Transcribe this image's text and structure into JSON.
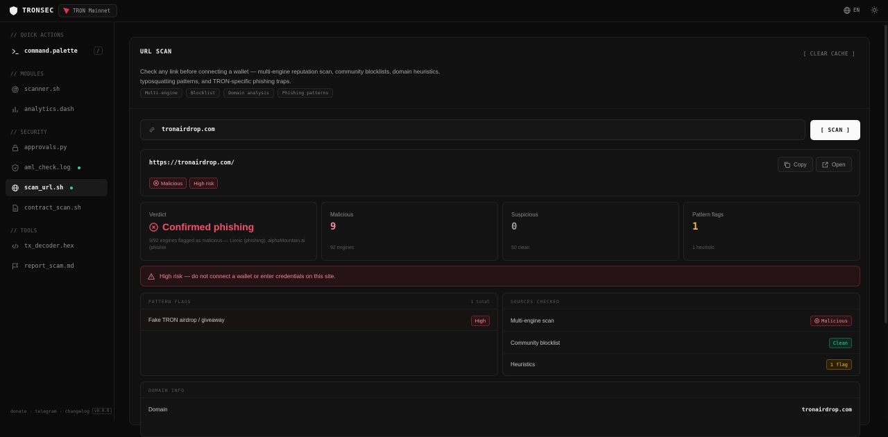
{
  "topbar": {
    "brand": "TRONSEC",
    "network": "TRON Mainnet",
    "language": "EN",
    "icons": [
      "shield-icon",
      "tron-logo-icon",
      "globe-icon",
      "sun-icon"
    ]
  },
  "sidebar": {
    "quick_actions_label": "// QUICK ACTIONS",
    "command_palette": "command.palette",
    "command_shortcut": "/",
    "modules_label": "// MODULES",
    "scanner": "scanner.sh",
    "analytics": "analytics.dash",
    "security_label": "// SECURITY",
    "approvals": "approvals.py",
    "aml_check": "aml_check.log",
    "scan_url": "scan_url.sh",
    "contract_scan": "contract_scan.sh",
    "tools_label": "// TOOLS",
    "tx_decoder": "tx_decoder.hex",
    "report_scam": "report_scam.md",
    "footer": {
      "donate": "donate",
      "telegram": "telegram",
      "changelog": "changelog",
      "sep": "·",
      "version": "v0.0.0"
    }
  },
  "main": {
    "title": "URL SCAN",
    "clear_cache": "[ CLEAR CACHE ]",
    "description": "Check any link before connecting a wallet — multi-engine reputation scan, community blocklists, domain heuristics, typosquatting patterns, and TRON-specific phishing traps.",
    "tags": [
      "Multi-engine",
      "Blocklist",
      "Domain analysis",
      "Phishing patterns"
    ],
    "input_value": "tronairdrop.com",
    "scan_label": "[ SCAN ]",
    "result": {
      "full_url": "https://tronairdrop.com/",
      "badge_malicious": "Malicious",
      "badge_risk": "High risk",
      "copy_label": "Copy",
      "open_label": "Open"
    },
    "stats": {
      "verdict_label": "Verdict",
      "verdict_value": "Confirmed phishing",
      "verdict_detail": "9/92 engines flagged as malicious — Lionic (phishing), alphaMountain.ai (phishin",
      "malicious_label": "Malicious",
      "malicious_value": "9",
      "malicious_sub": "92 engines",
      "suspicious_label": "Suspicious",
      "suspicious_value": "0",
      "suspicious_sub": "50 clean",
      "flags_label": "Pattern flags",
      "flags_value": "1",
      "flags_sub": "1 heuristic"
    },
    "alert": "High risk — do not connect a wallet or enter credentials on this site.",
    "pattern_flags": {
      "title": "PATTERN FLAGS",
      "count": "1 total",
      "items": [
        {
          "name": "Fake TRON airdrop / giveaway",
          "severity": "High"
        }
      ]
    },
    "sources": {
      "title": "SOURCES CHECKED",
      "items": [
        {
          "name": "Multi-engine scan",
          "status": "Malicious"
        },
        {
          "name": "Community blocklist",
          "status": "Clean"
        },
        {
          "name": "Heuristics",
          "status": "1 flag"
        }
      ]
    },
    "domain_info": {
      "title": "DOMAIN INFO",
      "domain_label": "Domain",
      "domain_value": "tronairdrop.com"
    }
  },
  "colors": {
    "danger": "#f08a96",
    "danger_strong": "#f5516b",
    "success": "#34d399",
    "warning": "#f5b83d",
    "background": "#0b0b0b"
  }
}
